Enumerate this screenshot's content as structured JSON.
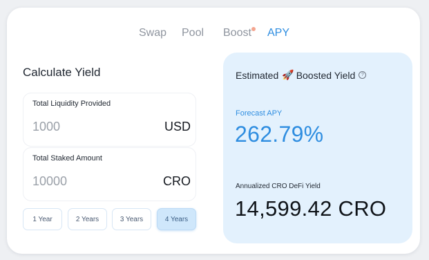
{
  "nav": {
    "tabs": [
      {
        "label": "Swap"
      },
      {
        "label": "Pool"
      },
      {
        "label": "Boost"
      },
      {
        "label": "APY"
      }
    ],
    "active": "APY"
  },
  "calculator": {
    "title": "Calculate Yield",
    "liquidity": {
      "label": "Total Liquidity Provided",
      "value": "1000",
      "unit": "USD"
    },
    "staked": {
      "label": "Total Staked Amount",
      "value": "10000",
      "unit": "CRO"
    },
    "periods": [
      "1 Year",
      "2 Years",
      "3 Years",
      "4 Years"
    ],
    "selected_period": "4 Years"
  },
  "estimate": {
    "title_prefix": "Estimated",
    "title_suffix": "Boosted Yield",
    "rocket_icon": "🚀",
    "help_icon": "?",
    "forecast_label": "Forecast APY",
    "forecast_value": "262.79%",
    "annual_label": "Annualized CRO DeFi Yield",
    "annual_value": "14,599.42 CRO"
  },
  "colors": {
    "accent": "#2e8de0",
    "panel_bg": "#e3f1fd",
    "notification_dot": "#f4a58f"
  }
}
